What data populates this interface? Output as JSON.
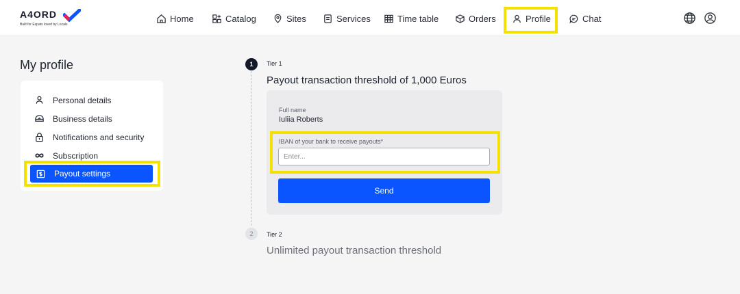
{
  "brand": {
    "name": "A4ORD",
    "tagline": "Built for Expats loved by Locals",
    "accent": "#0a55ff",
    "highlight": "#f5e100"
  },
  "nav": {
    "items": [
      {
        "label": "Home",
        "icon": "home-icon"
      },
      {
        "label": "Catalog",
        "icon": "catalog-icon"
      },
      {
        "label": "Sites",
        "icon": "map-pin-icon"
      },
      {
        "label": "Services",
        "icon": "services-icon"
      },
      {
        "label": "Time table",
        "icon": "calendar-grid-icon"
      },
      {
        "label": "Orders",
        "icon": "box-icon"
      },
      {
        "label": "Profile",
        "icon": "user-icon",
        "active": true
      },
      {
        "label": "Chat",
        "icon": "chat-icon"
      }
    ],
    "right_icons": [
      "globe-icon",
      "account-icon"
    ]
  },
  "sidebar": {
    "title": "My profile",
    "items": [
      {
        "label": "Personal details",
        "icon": "user-icon"
      },
      {
        "label": "Business details",
        "icon": "handshake-icon"
      },
      {
        "label": "Notifications and security",
        "icon": "lock-icon"
      },
      {
        "label": "Subscription",
        "icon": "infinity-icon"
      },
      {
        "label": "Payout settings",
        "icon": "wallet-dollar-icon",
        "active": true
      }
    ]
  },
  "tiers": [
    {
      "number": "1",
      "label": "Tier 1",
      "title": "Payout transaction threshold of 1,000 Euros",
      "form": {
        "full_name_label": "Full name",
        "full_name_value": "Iuliia Roberts",
        "iban_label": "IBAN of your bank to receive payouts*",
        "iban_placeholder": "Enter...",
        "iban_value": "",
        "send_label": "Send"
      }
    },
    {
      "number": "2",
      "label": "Tier 2",
      "title": "Unlimited payout transaction threshold"
    }
  ]
}
